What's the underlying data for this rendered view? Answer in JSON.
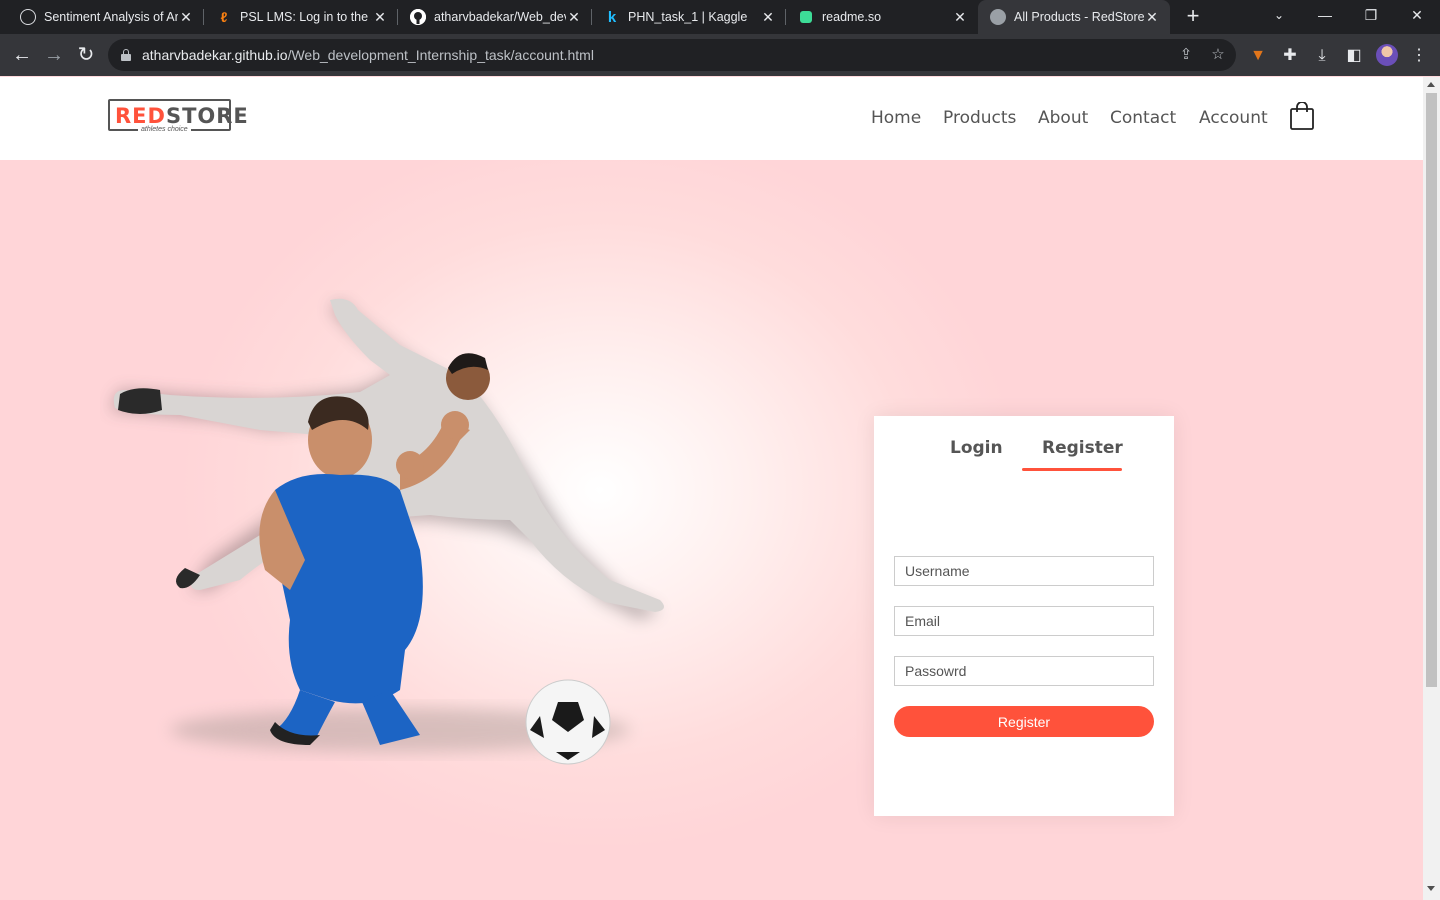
{
  "browser": {
    "tabs": [
      {
        "title": "Sentiment Analysis of Ar",
        "icon": "openai-icon",
        "color": "#ffffff"
      },
      {
        "title": "PSL LMS: Log in to the si",
        "icon": "moodle-icon",
        "color": "#f98012"
      },
      {
        "title": "atharvbadekar/Web_dev",
        "icon": "github-icon",
        "color": "#ffffff"
      },
      {
        "title": "PHN_task_1 | Kaggle",
        "icon": "kaggle-icon",
        "color": "#20beff"
      },
      {
        "title": "readme.so",
        "icon": "readme-icon",
        "color": "#3ddc97"
      },
      {
        "title": "All Products - RedStore",
        "icon": "globe-icon",
        "color": "#9aa0a6"
      }
    ],
    "url_host": "atharvbadekar.github.io",
    "url_path": "/Web_development_Internship_task/account.html"
  },
  "site": {
    "logo_text_red": "RED",
    "logo_text_rest": "STORE",
    "logo_tagline": "athletes choice",
    "nav": [
      "Home",
      "Products",
      "About",
      "Contact",
      "Account"
    ],
    "accent_color": "#ff523b"
  },
  "form": {
    "tab_login": "Login",
    "tab_register": "Register",
    "active_tab": "Register",
    "username_placeholder": "Username",
    "email_placeholder": "Email",
    "password_placeholder": "Passowrd",
    "submit_label": "Register"
  }
}
